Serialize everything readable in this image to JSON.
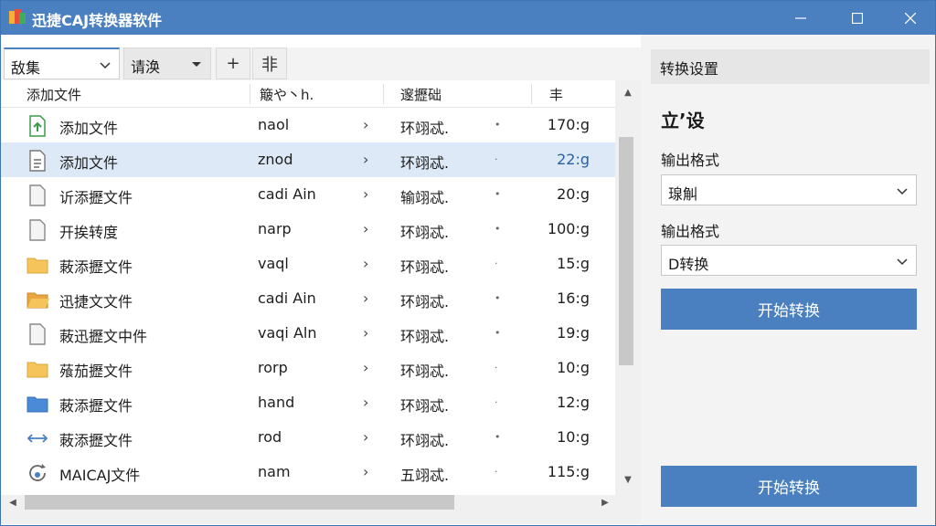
{
  "app": {
    "title": "迅捷CAJ转换器软件",
    "colors": {
      "accent": "#4a80bf",
      "selected_row": "#dde9f7"
    }
  },
  "toolbar": {
    "combo1": "敌集",
    "combo2": "请涣",
    "plus": "+",
    "list": "非"
  },
  "table": {
    "headers": [
      "添加文件",
      "簸や丶h.",
      "邃攊础",
      "丰"
    ],
    "rows": [
      {
        "icon": "file-add-icon",
        "name": "添加文件",
        "code": "naol",
        "chev": "›",
        "format": "环翊忒.",
        "dot": "•",
        "size": "170:g"
      },
      {
        "icon": "document-icon",
        "name": "添加文件",
        "code": "znod",
        "chev": "›",
        "format": "环翊忒.",
        "dot": "·",
        "size": "22:g"
      },
      {
        "icon": "blank-file-icon",
        "name": "䜣添攊文件",
        "code": "cadi Ain",
        "chev": "›",
        "format": "输翊忒.",
        "dot": "•",
        "size": "20:g"
      },
      {
        "icon": "blank-file-icon",
        "name": "开挨转度",
        "code": "narp",
        "chev": "›",
        "format": "环翊忒.",
        "dot": "•",
        "size": "100:g"
      },
      {
        "icon": "folder-icon",
        "name": "蓛添攊文件",
        "code": "vaql",
        "chev": "›",
        "format": "环翊忒.",
        "dot": "·",
        "size": "15:g"
      },
      {
        "icon": "open-folder-icon",
        "name": "迅捷文文件",
        "code": "cadi Ain",
        "chev": "›",
        "format": "环翊忒.",
        "dot": "•",
        "size": "16:g"
      },
      {
        "icon": "blank-file-icon",
        "name": "蓛迅攊文中件",
        "code": "vaqi Aln",
        "chev": "›",
        "format": "环翊忒.",
        "dot": "•",
        "size": "19:g"
      },
      {
        "icon": "folder-icon",
        "name": "蕵茄攊文件",
        "code": "rorp",
        "chev": "›",
        "format": "环翊忒.",
        "dot": "·",
        "size": "10:g"
      },
      {
        "icon": "blue-folder-icon",
        "name": "蓛添攊文件",
        "code": "hand",
        "chev": "›",
        "format": "环翊忒.",
        "dot": "·",
        "size": "12:g"
      },
      {
        "icon": "arrows-icon",
        "name": "蓛添攊文件",
        "code": "rod",
        "chev": "›",
        "format": "环翊忒.",
        "dot": "•",
        "size": "10:g"
      },
      {
        "icon": "refresh-icon",
        "name": "MAICAJ文件",
        "code": "nam",
        "chev": "›",
        "format": "五翊忒.",
        "dot": "·",
        "size": "115:g"
      }
    ]
  },
  "settings": {
    "header": "转换设置",
    "section": "立’设",
    "label1": "输出格式",
    "select1": "瑔觓",
    "label2": "输出格式",
    "select2": "D转换",
    "start_button": "开始转换",
    "start_button_bottom": "开始转换"
  }
}
